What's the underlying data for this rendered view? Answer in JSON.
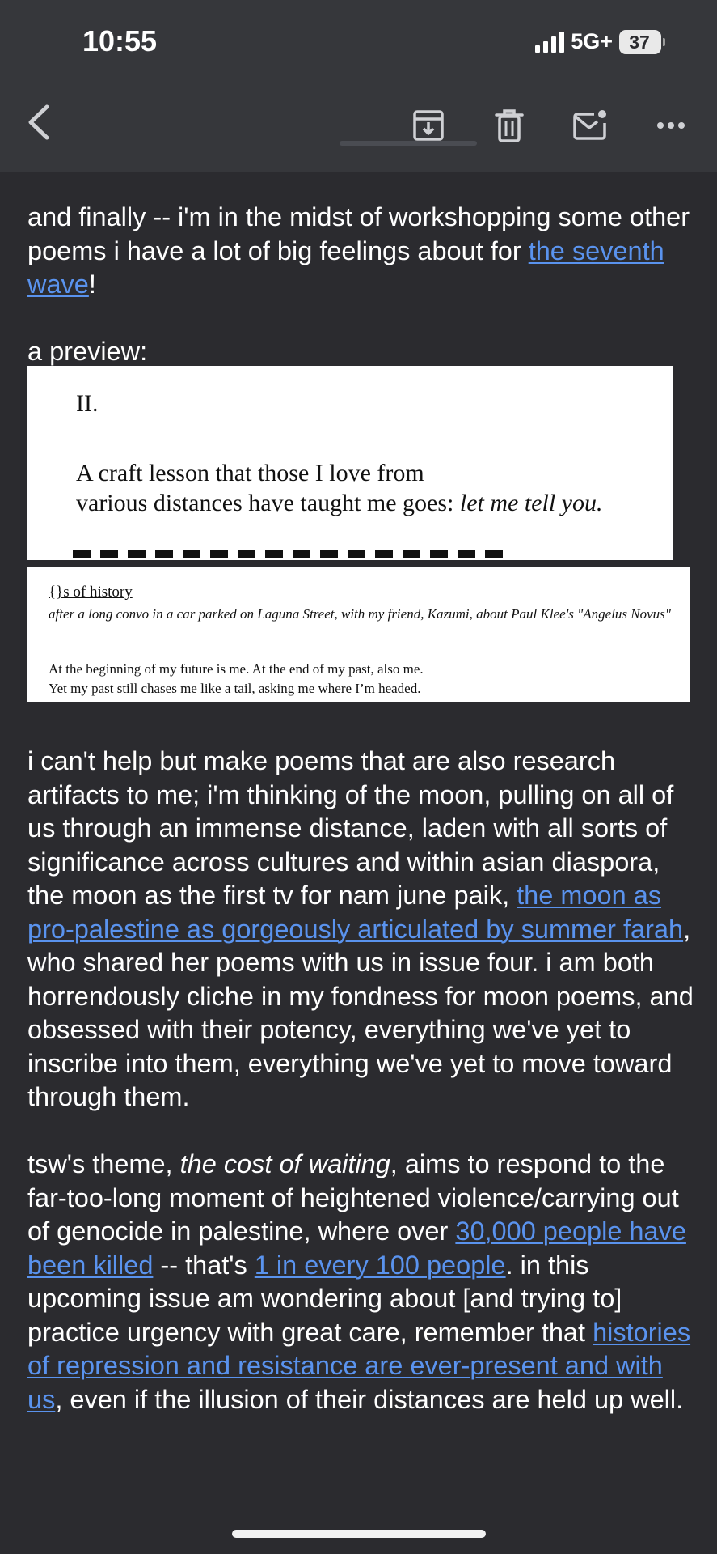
{
  "status_bar": {
    "time": "10:55",
    "network": "5G+",
    "battery": "37"
  },
  "toolbar": {
    "back_label": "back",
    "archive_label": "archive",
    "delete_label": "delete",
    "mark_label": "mark-unread",
    "more_label": "more"
  },
  "body": {
    "p1": "and finally -- i'm in the midst of workshopping some other poems i have a lot of big feelings about for ",
    "p1_link": "the seventh wave",
    "p1_end": "!",
    "preview_label": "a preview:",
    "preview_1": {
      "heading": "II.",
      "line1": "A craft lesson that those I love from",
      "line2_start": "various distances have taught me goes: ",
      "line2_italic": "let me tell you."
    },
    "preview_2": {
      "title": "{}s of history",
      "subtitle": "after a long convo in a car parked on Laguna Street, with my friend, Kazumi, about Paul Klee's \"Angelus Novus\"",
      "line1": "At the beginning of my future is me. At the end of my past, also me.",
      "line2": "Yet my past still chases me like a tail, asking me where I’m headed."
    },
    "p2_a": "i can't help but make poems that are also research artifacts to me; i'm thinking of the moon, pulling on all of us through an immense distance, laden with all sorts of significance across cultures and within asian diaspora, the moon as the first tv for nam june paik, ",
    "p2_link": "the moon as pro-palestine as gorgeously articulated by summer farah",
    "p2_b": ", who shared her poems with us in issue four. i am both horrendously cliche in my fondness for moon poems, and obsessed with their potency, everything we've yet to inscribe into them, everything we've yet to move toward through them.",
    "p3_a": "tsw's theme, ",
    "p3_italic": "the cost of waiting",
    "p3_b": ", aims to respond to the far-too-long moment of heightened violence/carrying out of genocide in palestine, where over ",
    "p3_link1": "30,000 people have been killed",
    "p3_c": " -- that's ",
    "p3_link2": "1 in every 100 people",
    "p3_d": ". in this upcoming issue am wondering about [and trying to] practice urgency with great care, remember that ",
    "p3_link3": "histories of repression and resistance are ever-present and with us",
    "p3_e": ", even if the illusion of their distances are held up well."
  }
}
